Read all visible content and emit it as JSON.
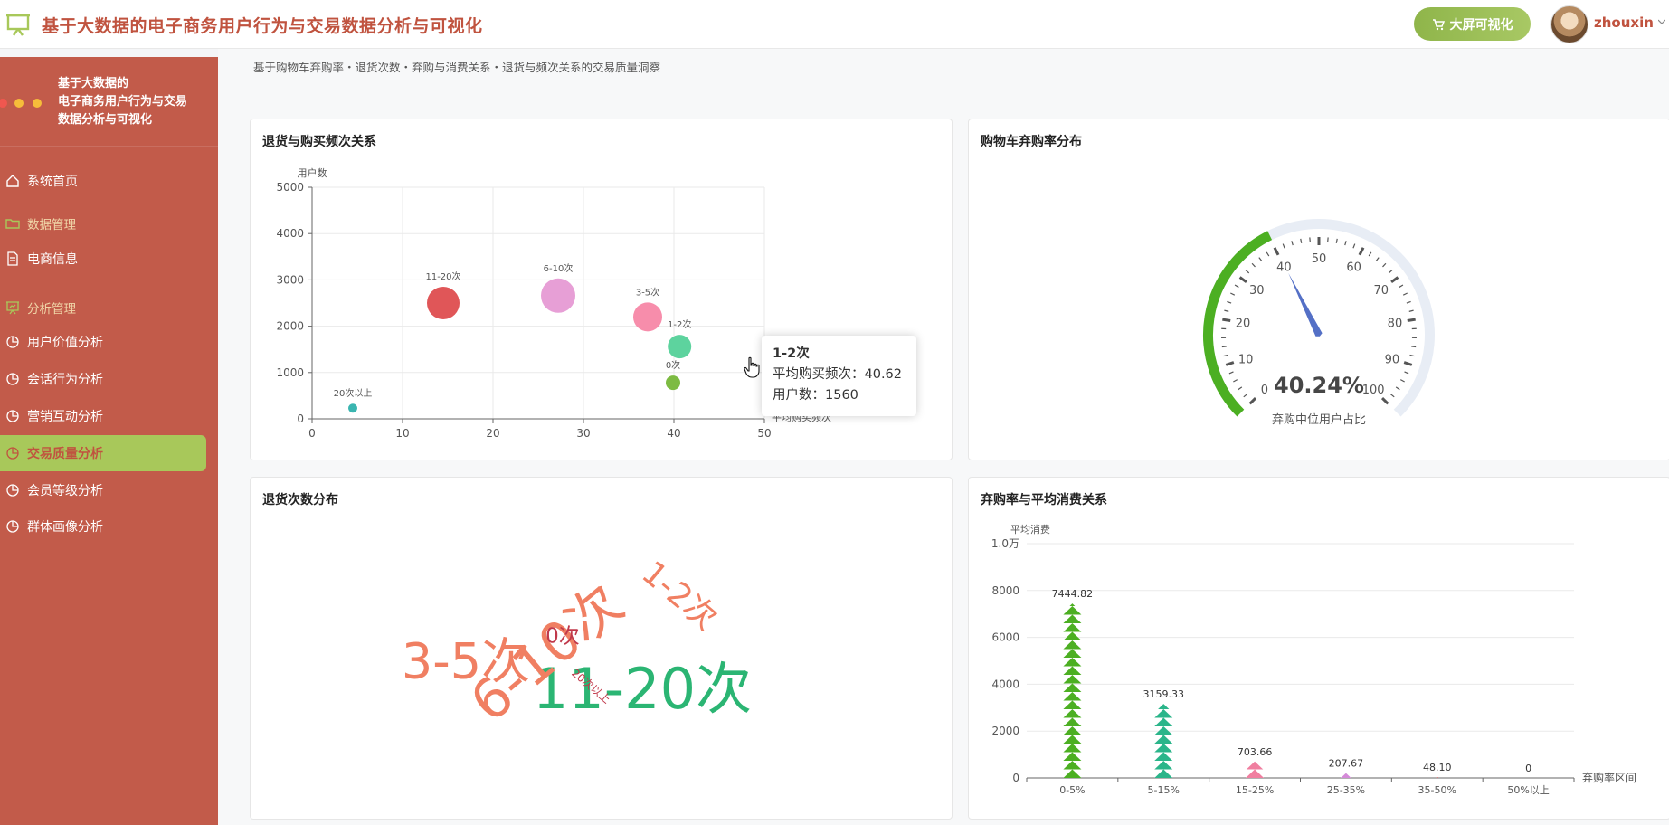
{
  "app": {
    "title": "基于大数据的电子商务用户行为与交易数据分析与可视化",
    "big_screen_button": "大屏可视化",
    "username": "zhouxin"
  },
  "sidebar": {
    "title_line1": "基于大数据的",
    "title_line2": "电子商务用户行为与交易",
    "title_line3": "数据分析与可视化",
    "items": [
      {
        "label": "系统首页",
        "icon": "home-icon",
        "type": "item"
      },
      {
        "label": "数据管理",
        "icon": "folder-icon",
        "type": "group"
      },
      {
        "label": "电商信息",
        "icon": "document-icon",
        "type": "item"
      },
      {
        "label": "分析管理",
        "icon": "presentation-icon",
        "type": "group"
      },
      {
        "label": "用户价值分析",
        "icon": "pie-chart-icon",
        "type": "item"
      },
      {
        "label": "会话行为分析",
        "icon": "pie-chart-icon",
        "type": "item"
      },
      {
        "label": "营销互动分析",
        "icon": "pie-chart-icon",
        "type": "item"
      },
      {
        "label": "交易质量分析",
        "icon": "pie-chart-icon",
        "type": "item",
        "active": true
      },
      {
        "label": "会员等级分析",
        "icon": "pie-chart-icon",
        "type": "item"
      },
      {
        "label": "群体画像分析",
        "icon": "pie-chart-icon",
        "type": "item"
      }
    ]
  },
  "page": {
    "subtitle": "基于购物车弃购率・退货次数・弃购与消费关系・退货与频次关系的交易质量洞察"
  },
  "panels": {
    "scatter_title": "退货与购买频次关系",
    "gauge_title": "购物车弃购率分布",
    "wordcloud_title": "退货次数分布",
    "bar_title": "弃购率与平均消费关系"
  },
  "tooltip": {
    "title": "1-2次",
    "line1": "平均购买频次：40.62",
    "line2": "用户数：1560"
  },
  "colors": {
    "brand": "#c0533f",
    "sidebar": "#c25b4a",
    "active": "#a8c85a"
  },
  "chart_data": [
    {
      "type": "scatter",
      "title": "退货与购买频次关系",
      "xlabel": "平均购买频次",
      "ylabel": "用户数",
      "xlim": [
        0,
        50
      ],
      "ylim": [
        0,
        5000
      ],
      "x_ticks": [
        "0",
        "10",
        "20",
        "30",
        "40",
        "50"
      ],
      "y_ticks": [
        "0",
        "1000",
        "2000",
        "3000",
        "4000",
        "5000"
      ],
      "grid": true,
      "points": [
        {
          "label": "20次以上",
          "x": 4.5,
          "y": 230,
          "color": "#3ab5b0",
          "r": 5
        },
        {
          "label": "11-20次",
          "x": 14.5,
          "y": 2500,
          "color": "#e05658",
          "r": 18
        },
        {
          "label": "6-10次",
          "x": 27.2,
          "y": 2660,
          "color": "#e79fd6",
          "r": 19
        },
        {
          "label": "3-5次",
          "x": 37.1,
          "y": 2200,
          "color": "#f78dab",
          "r": 16
        },
        {
          "label": "1-2次",
          "x": 40.62,
          "y": 1560,
          "color": "#5dd39e",
          "r": 13
        },
        {
          "label": "0次",
          "x": 39.9,
          "y": 780,
          "color": "#7dbb42",
          "r": 8
        }
      ]
    },
    {
      "type": "gauge",
      "title": "购物车弃购率分布",
      "value": 40.24,
      "value_label": "40.24%",
      "caption": "弃购中位用户占比",
      "min": 0,
      "max": 100,
      "ticks": [
        "0",
        "10",
        "20",
        "30",
        "40",
        "50",
        "60",
        "70",
        "80",
        "90",
        "100"
      ],
      "progress_color": "#4caf22",
      "track_color": "#e8edf5",
      "pointer_color": "#5470c6"
    },
    {
      "type": "wordcloud",
      "title": "退货次数分布",
      "words": [
        {
          "text": "11-20次",
          "color": "#2bb573"
        },
        {
          "text": "6-10次",
          "color": "#f07f62"
        },
        {
          "text": "3-5次",
          "color": "#f07f62"
        },
        {
          "text": "1-2次",
          "color": "#f07f62"
        },
        {
          "text": "0次",
          "color": "#c0394b"
        },
        {
          "text": "20次以上",
          "color": "#c0394b"
        }
      ]
    },
    {
      "type": "bar",
      "title": "弃购率与平均消费关系",
      "xlabel": "弃购率区间",
      "ylabel": "平均消费",
      "categories": [
        "0-5%",
        "5-15%",
        "15-25%",
        "25-35%",
        "35-50%",
        "50%以上"
      ],
      "values": [
        7444.82,
        3159.33,
        703.66,
        207.67,
        48.1,
        0
      ],
      "value_labels": [
        "7444.82",
        "3159.33",
        "703.66",
        "207.67",
        "48.10",
        "0"
      ],
      "colors": [
        "#4caf22",
        "#2bb58a",
        "#f07fa0",
        "#d48ad8",
        "#d6373c",
        "#999999"
      ],
      "ylim": [
        0,
        10000
      ],
      "y_ticks": [
        "0",
        "2000",
        "4000",
        "6000",
        "8000",
        "1.0万"
      ]
    }
  ]
}
